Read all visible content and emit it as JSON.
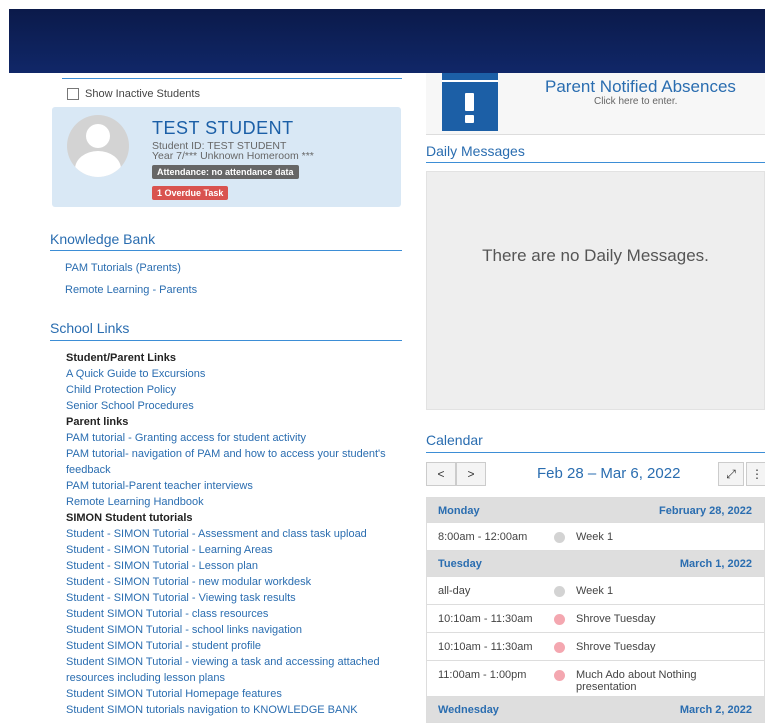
{
  "student": {
    "show_inactive_label": "Show Inactive Students",
    "name": "TEST STUDENT",
    "id_line": "Student ID: TEST STUDENT",
    "homeroom_line": "Year 7/*** Unknown Homeroom ***",
    "attendance_badge": "Attendance: no attendance data",
    "overdue_badge": "1 Overdue Task"
  },
  "knowledge_bank": {
    "title": "Knowledge Bank",
    "links": [
      "PAM Tutorials (Parents)",
      "Remote Learning - Parents"
    ]
  },
  "school_links": {
    "title": "School Links",
    "items": [
      {
        "type": "header",
        "text": "Student/Parent Links"
      },
      {
        "type": "link",
        "text": "A Quick Guide to Excursions"
      },
      {
        "type": "link",
        "text": "Child Protection Policy"
      },
      {
        "type": "link",
        "text": "Senior School Procedures"
      },
      {
        "type": "header",
        "text": "Parent links"
      },
      {
        "type": "link",
        "text": "PAM tutorial - Granting access for student activity"
      },
      {
        "type": "link",
        "text": "PAM tutorial- navigation of PAM and how to access your student's feedback"
      },
      {
        "type": "link",
        "text": "PAM tutorial-Parent teacher interviews"
      },
      {
        "type": "link",
        "text": "Remote Learning Handbook"
      },
      {
        "type": "header",
        "text": "SIMON Student tutorials"
      },
      {
        "type": "link",
        "text": "Student - SIMON Tutorial - Assessment and class task upload"
      },
      {
        "type": "link",
        "text": "Student - SIMON Tutorial - Learning Areas"
      },
      {
        "type": "link",
        "text": "Student - SIMON Tutorial - Lesson plan"
      },
      {
        "type": "link",
        "text": "Student - SIMON Tutorial - new modular workdesk"
      },
      {
        "type": "link",
        "text": "Student - SIMON Tutorial - Viewing task results"
      },
      {
        "type": "link",
        "text": "Student SIMON Tutorial - class resources"
      },
      {
        "type": "link",
        "text": "Student SIMON Tutorial - school links navigation"
      },
      {
        "type": "link",
        "text": "Student SIMON Tutorial - student profile"
      },
      {
        "type": "link",
        "text": "Student SIMON Tutorial - viewing a task and accessing attached resources including lesson plans"
      },
      {
        "type": "link",
        "text": "Student SIMON Tutorial Homepage features"
      },
      {
        "type": "link",
        "text": "Student SIMON tutorials navigation to KNOWLEDGE BANK"
      }
    ]
  },
  "absences": {
    "title": "Parent Notified Absences",
    "subtitle": "Click here to enter.",
    "icon": "exclamation-icon"
  },
  "daily_messages": {
    "title": "Daily Messages",
    "empty_text": "There are no Daily Messages."
  },
  "calendar": {
    "title": "Calendar",
    "prev_label": "<",
    "next_label": ">",
    "range": "Feb 28 – Mar 6, 2022",
    "expand_icon": "expand-icon",
    "menu_icon": "menu-dots-icon",
    "event_colors": {
      "grey": "#d3d3d3",
      "pink": "#f4a7b0"
    },
    "rows": [
      {
        "type": "day",
        "name": "Monday",
        "date": "February 28, 2022"
      },
      {
        "type": "event",
        "time": "8:00am - 12:00am",
        "title": "Week 1",
        "color": "grey"
      },
      {
        "type": "day",
        "name": "Tuesday",
        "date": "March 1, 2022"
      },
      {
        "type": "event",
        "time": "all-day",
        "title": "Week 1",
        "color": "grey"
      },
      {
        "type": "event",
        "time": "10:10am - 11:30am",
        "title": "Shrove Tuesday",
        "color": "pink"
      },
      {
        "type": "event",
        "time": "10:10am - 11:30am",
        "title": "Shrove Tuesday",
        "color": "pink"
      },
      {
        "type": "event",
        "time": "11:00am - 1:00pm",
        "title": "Much Ado about Nothing presentation",
        "color": "pink"
      },
      {
        "type": "day",
        "name": "Wednesday",
        "date": "March 2, 2022"
      }
    ]
  },
  "colors": {
    "header_bg": "#0b1a4a",
    "accent_blue": "#2a6db0",
    "card_bg": "#d9e8f5",
    "badge_grey": "#666666",
    "badge_red": "#d9534f"
  }
}
